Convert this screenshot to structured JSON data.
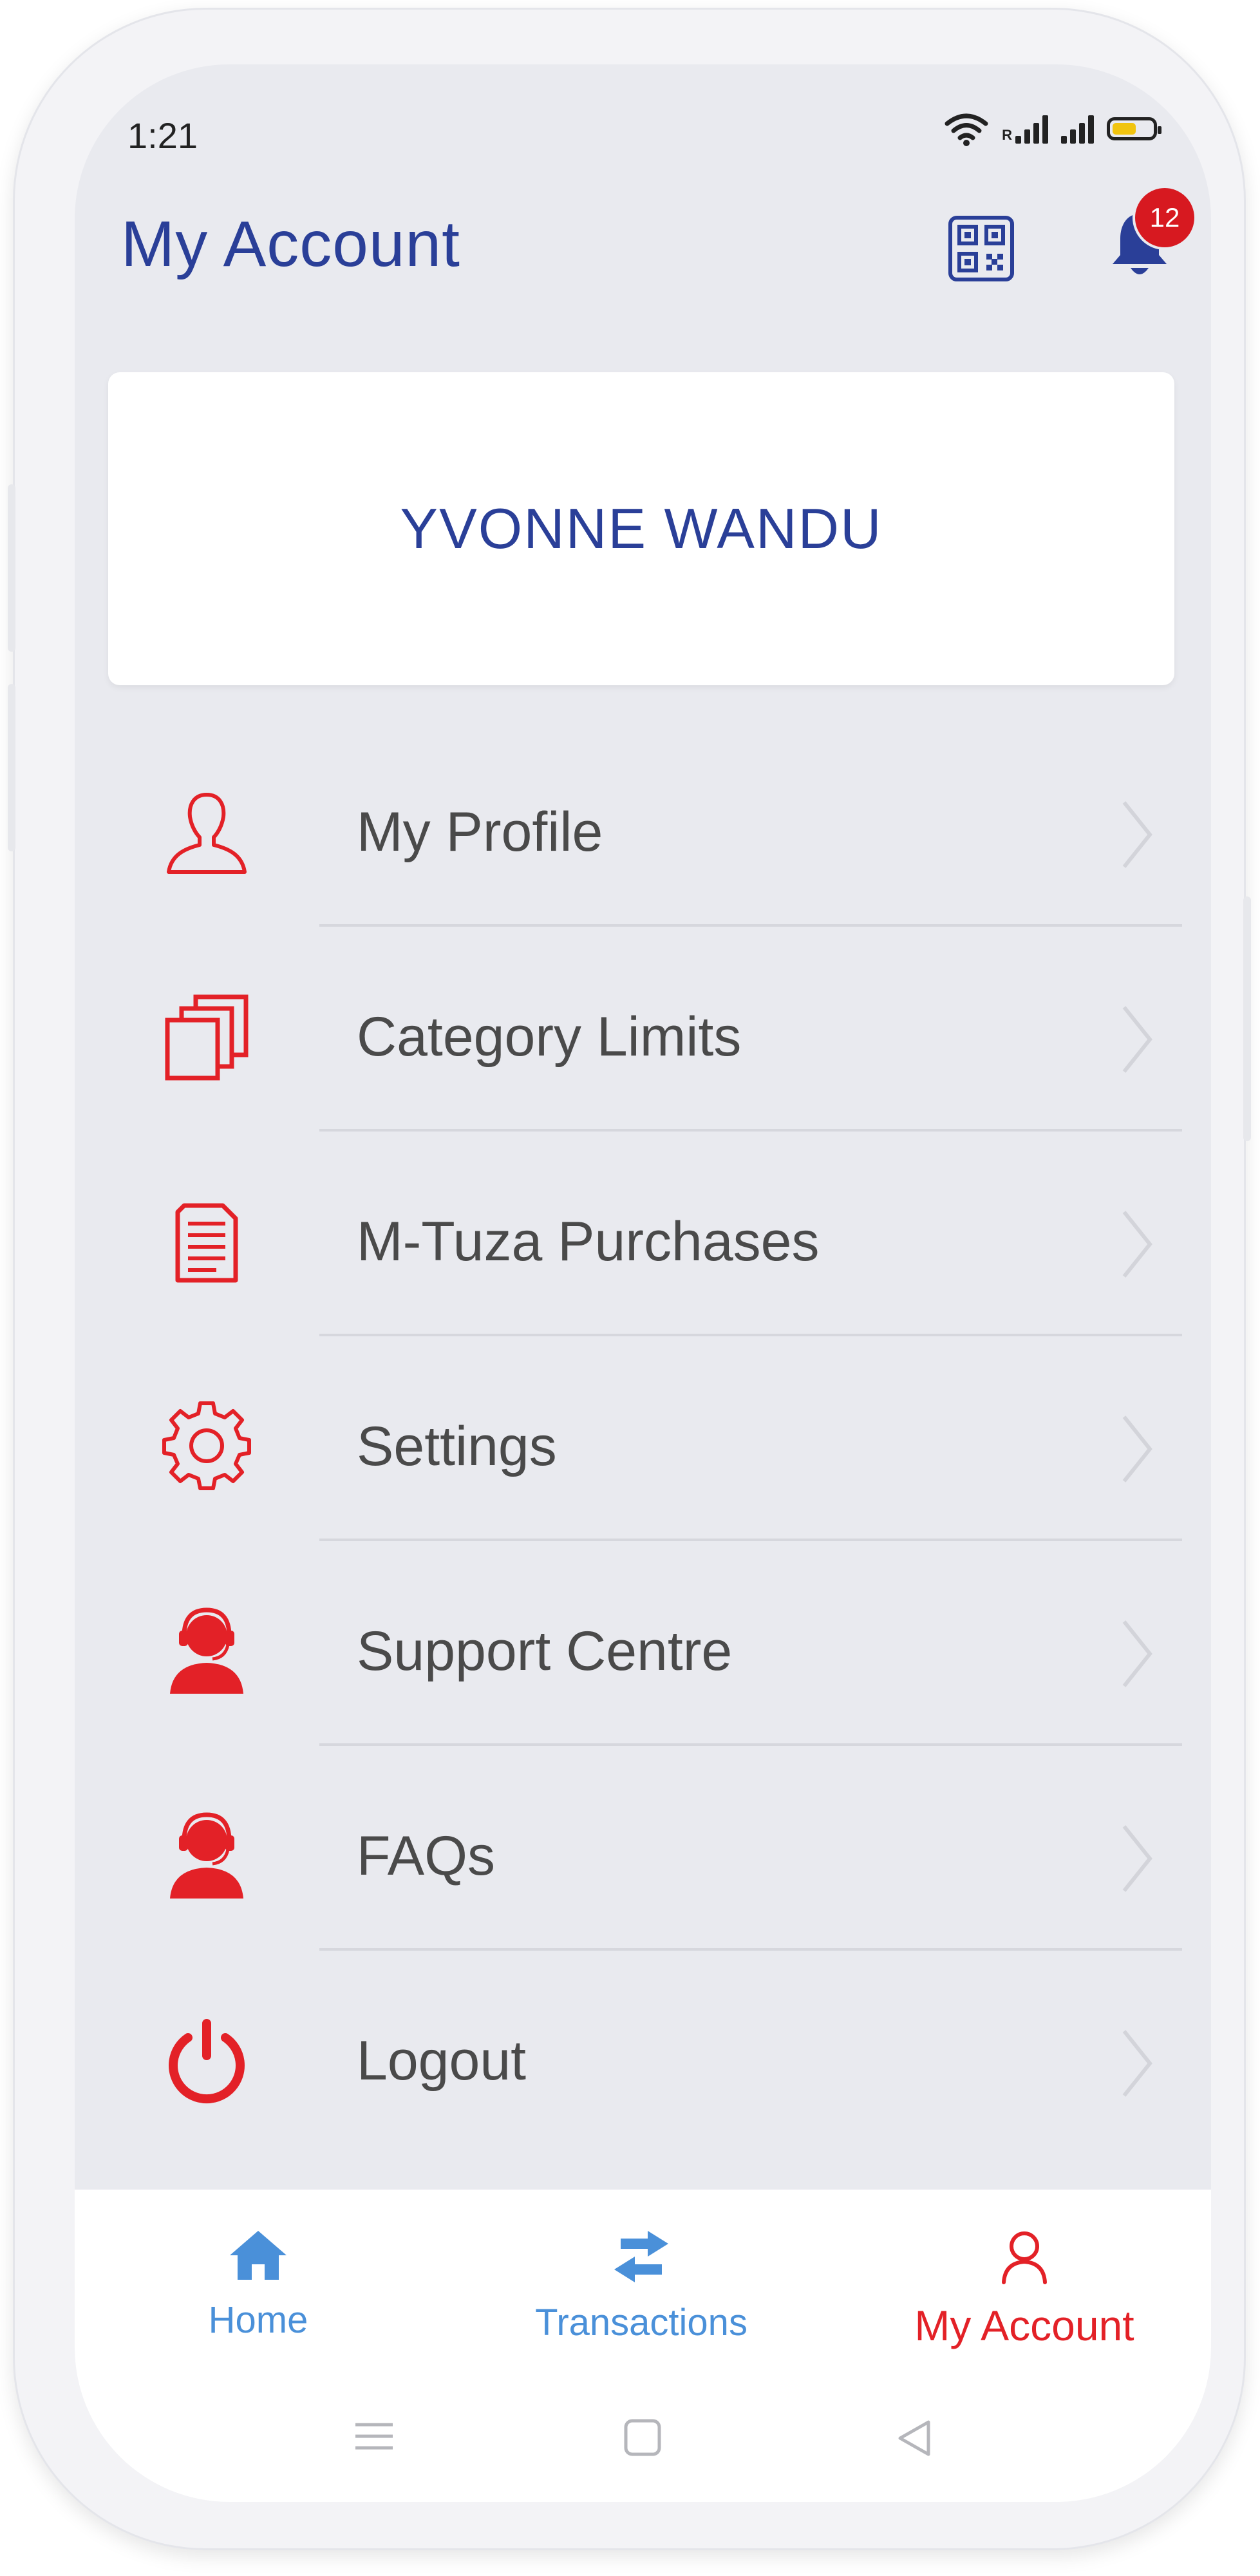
{
  "status_bar": {
    "time": "1:21",
    "roaming_indicator": "R"
  },
  "header": {
    "title": "My Account",
    "notification_count": "12"
  },
  "profile": {
    "name": "YVONNE WANDU"
  },
  "menu": [
    {
      "label": "My Profile",
      "icon": "person-outline-icon"
    },
    {
      "label": "Category Limits",
      "icon": "stacked-cards-icon"
    },
    {
      "label": "M-Tuza Purchases",
      "icon": "document-icon"
    },
    {
      "label": "Settings",
      "icon": "gear-icon"
    },
    {
      "label": "Support Centre",
      "icon": "support-agent-icon"
    },
    {
      "label": "FAQs",
      "icon": "support-agent-icon"
    },
    {
      "label": "Logout",
      "icon": "power-icon"
    }
  ],
  "bottom_nav": {
    "tabs": [
      {
        "label": "Home",
        "icon": "home-icon",
        "active": false
      },
      {
        "label": "Transactions",
        "icon": "swap-arrows-icon",
        "active": false
      },
      {
        "label": "My Account",
        "icon": "person-outline-icon",
        "active": true
      }
    ]
  },
  "colors": {
    "primary_blue": "#2a3f98",
    "accent_red": "#e32127",
    "tab_blue": "#4a90d9",
    "screen_bg": "#e9eaef"
  }
}
